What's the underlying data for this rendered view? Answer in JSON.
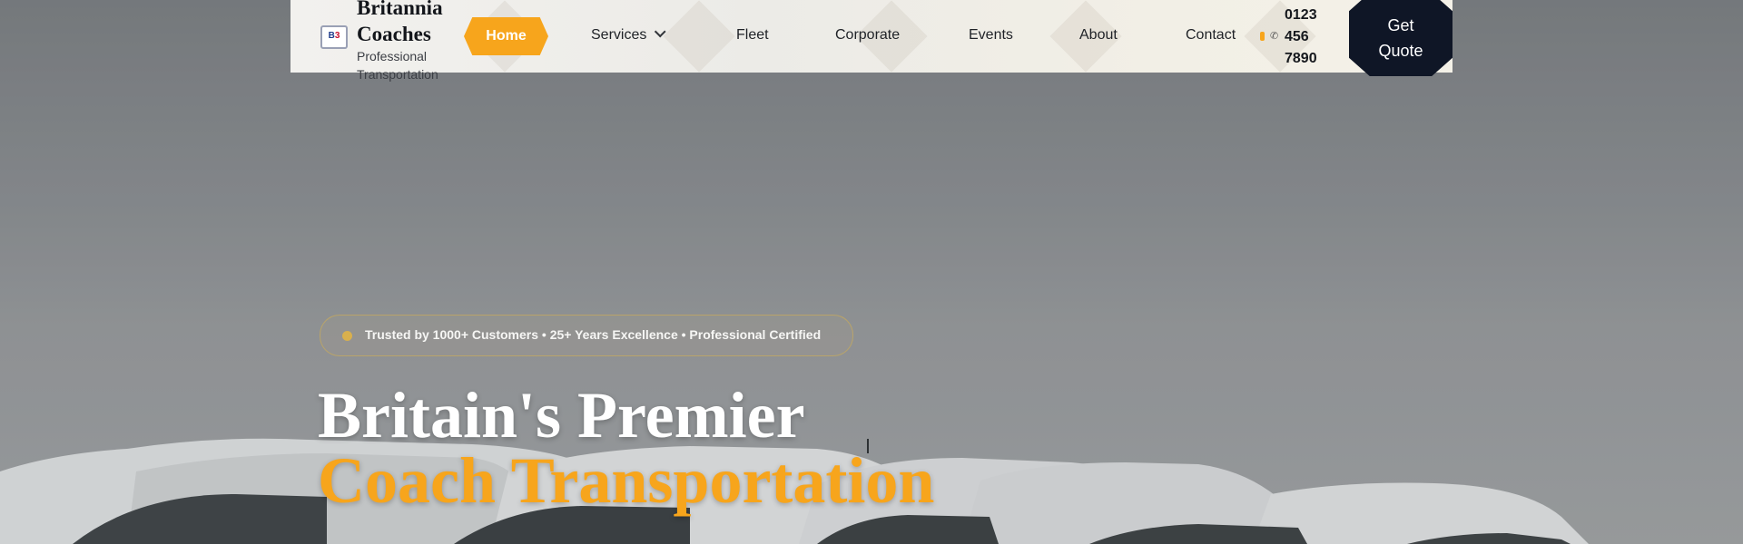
{
  "brand": {
    "badge_left": "B",
    "badge_right": "3",
    "title": "Britannia Coaches",
    "subtitle": "Professional Transportation"
  },
  "nav": {
    "items": [
      {
        "label": "Home",
        "active": true
      },
      {
        "label": "Services",
        "has_dropdown": true
      },
      {
        "label": "Fleet"
      },
      {
        "label": "Corporate"
      },
      {
        "label": "Events"
      },
      {
        "label": "About"
      },
      {
        "label": "Contact"
      }
    ]
  },
  "contact": {
    "phone_icon": "phone-icon",
    "phone": "0123 456 7890"
  },
  "cta": {
    "label": "Get Quote"
  },
  "hero": {
    "badge_text": "Trusted by 1000+ Customers • 25+ Years Excellence • Professional Certified",
    "headline_line1": "Britain's Premier",
    "headline_line2": "Coach Transportation"
  },
  "colors": {
    "accent": "#f7a51c",
    "navy": "#0f1626",
    "header_bg": "#f0efeb"
  }
}
